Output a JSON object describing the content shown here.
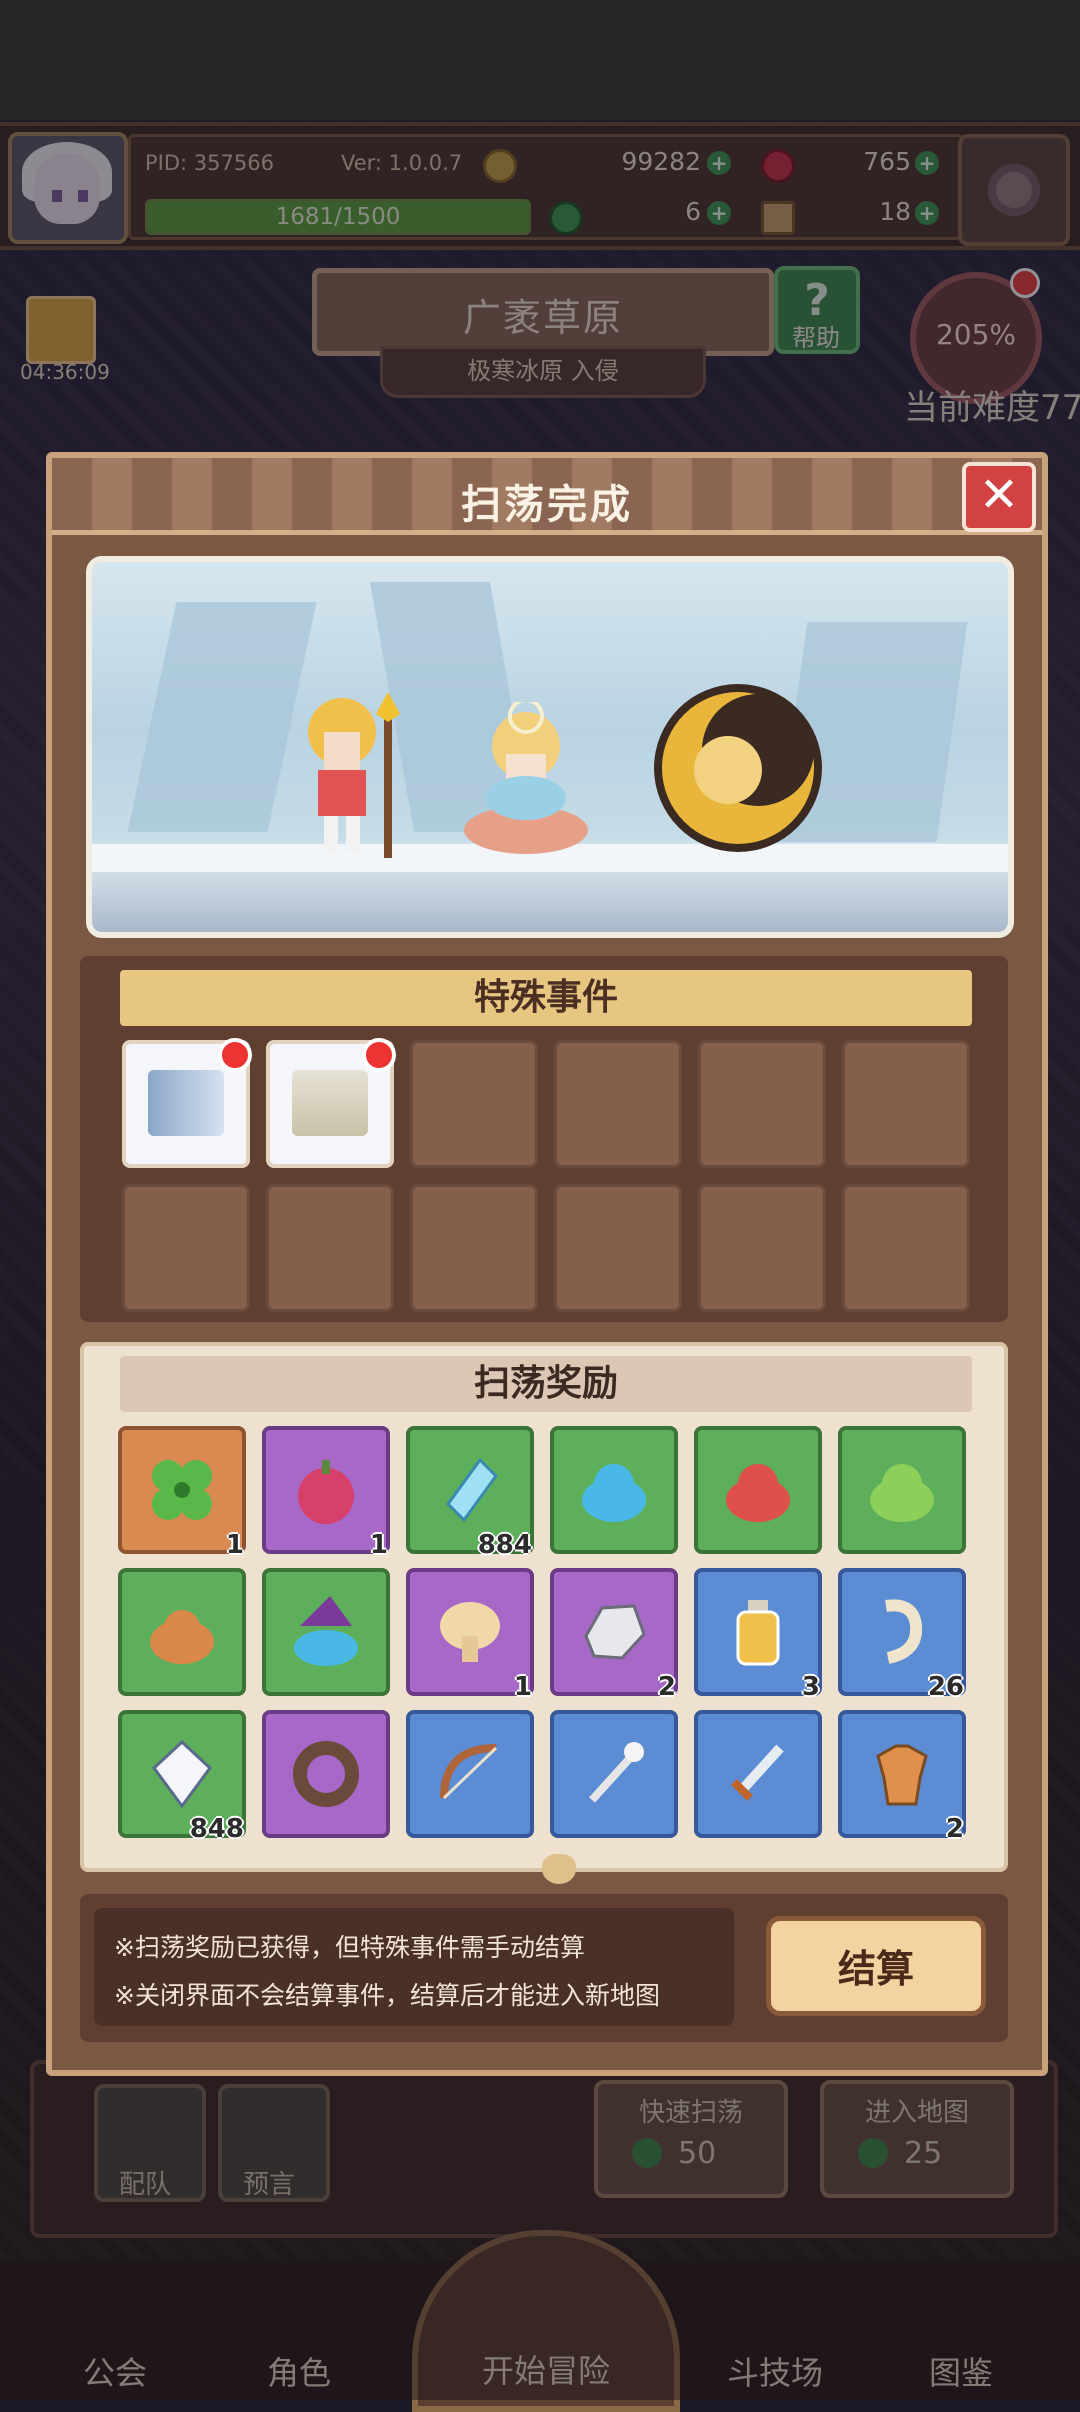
{
  "header": {
    "pid": "PID: 357566",
    "version": "Ver: 1.0.0.7",
    "gold": "99282",
    "gems": "765",
    "xp_text": "1681/1500",
    "xp_fill": 1.0,
    "clover": "6",
    "keys": "18"
  },
  "location": {
    "title": "广袤草原",
    "subtitle": "极寒冰原 入侵",
    "help_label": "帮助",
    "gift_timer": "04:36:09",
    "difficulty_pct": "205%",
    "difficulty_label": "当前难度77"
  },
  "modal": {
    "title": "扫荡完成",
    "close_glyph": "✕",
    "events_title": "特殊事件",
    "rewards_title": "扫荡奖励",
    "events": [
      {
        "name": "ice-key",
        "active": true
      },
      {
        "name": "ice-gate",
        "active": true
      },
      {
        "name": "empty"
      },
      {
        "name": "empty"
      },
      {
        "name": "empty"
      },
      {
        "name": "empty"
      },
      {
        "name": "empty"
      },
      {
        "name": "empty"
      },
      {
        "name": "empty"
      },
      {
        "name": "empty"
      },
      {
        "name": "empty"
      },
      {
        "name": "empty"
      }
    ],
    "rewards": [
      {
        "icon": "clover-icon",
        "bg": "orange",
        "qty": "1"
      },
      {
        "icon": "berry-icon",
        "bg": "purple",
        "qty": "1"
      },
      {
        "icon": "crystal-icon",
        "bg": "green",
        "qty": "884"
      },
      {
        "icon": "blue-slime-icon",
        "bg": "green",
        "qty": ""
      },
      {
        "icon": "red-slime-icon",
        "bg": "green",
        "qty": ""
      },
      {
        "icon": "green-slime-icon",
        "bg": "green",
        "qty": ""
      },
      {
        "icon": "orange-slime-icon",
        "bg": "green",
        "qty": ""
      },
      {
        "icon": "witch-slime-icon",
        "bg": "green",
        "qty": ""
      },
      {
        "icon": "mushroom-icon",
        "bg": "purple",
        "qty": "1"
      },
      {
        "icon": "ore-icon",
        "bg": "purple",
        "qty": "2"
      },
      {
        "icon": "potion-icon",
        "bg": "blue",
        "qty": "3"
      },
      {
        "icon": "bone-icon",
        "bg": "blue",
        "qty": "26"
      },
      {
        "icon": "diamond-icon",
        "bg": "green",
        "qty": "848"
      },
      {
        "icon": "ring-icon",
        "bg": "purple",
        "qty": ""
      },
      {
        "icon": "bow-icon",
        "bg": "blue",
        "qty": ""
      },
      {
        "icon": "wand-icon",
        "bg": "blue",
        "qty": ""
      },
      {
        "icon": "sword-icon",
        "bg": "blue",
        "qty": ""
      },
      {
        "icon": "armor-icon",
        "bg": "blue",
        "qty": "2"
      }
    ],
    "note_1": "※扫荡奖励已获得，但特殊事件需手动结算",
    "note_2": "※关闭界面不会结算事件，结算后才能进入新地图",
    "settle_label": "结算"
  },
  "lower": {
    "team_label": "配队",
    "prophecy_label": "预言",
    "quick_sweep_label": "快速扫荡",
    "quick_sweep_cost": "50",
    "enter_map_label": "进入地图",
    "enter_map_cost": "25"
  },
  "nav": {
    "guild": "公会",
    "roles": "角色",
    "adventure": "开始冒险",
    "arena": "斗技场",
    "codex": "图鉴"
  },
  "colors": {
    "accent_gold": "#e7c681",
    "close_red": "#d34242",
    "panel_brown": "#7a5844"
  }
}
